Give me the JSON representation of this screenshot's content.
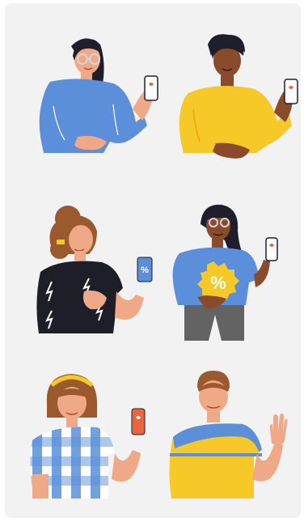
{
  "illustration": {
    "people": [
      {
        "name": "woman-glasses-blue-sweater",
        "props": [
          "phone-icon"
        ]
      },
      {
        "name": "man-yellow-sweater",
        "props": [
          "phone-icon"
        ]
      },
      {
        "name": "woman-bun-lightning-shirt",
        "props": [
          "card-percent-icon"
        ]
      },
      {
        "name": "woman-glasses-percent-badge",
        "props": [
          "percent-badge-icon",
          "phone-icon"
        ]
      },
      {
        "name": "woman-headband-gingham-shirt",
        "props": [
          "phone-icon"
        ]
      },
      {
        "name": "man-waving-striped-shirt",
        "props": [
          "wave-hand-icon"
        ]
      }
    ]
  },
  "colors": {
    "background": "#f2f2f2",
    "blue": "#5b8fd9",
    "yellow": "#f6c928",
    "dark": "#1e1e28",
    "orange": "#e8663e",
    "skin_light": "#f0a987",
    "skin_medium": "#c47a4e",
    "skin_dark": "#8a4b2c",
    "hair_dark": "#1f1f2b",
    "hair_brown": "#9a5a2e"
  }
}
